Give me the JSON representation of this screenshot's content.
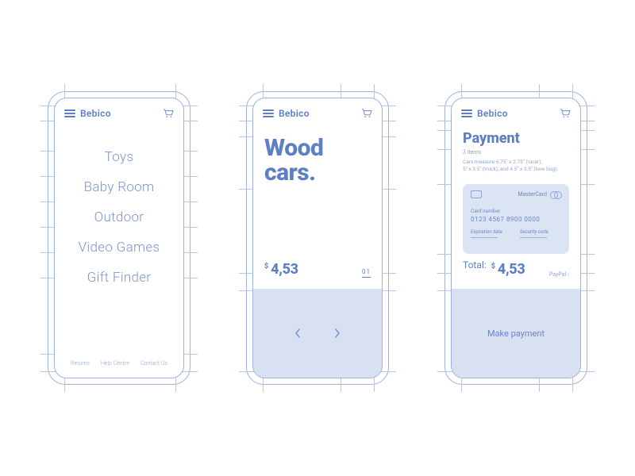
{
  "brand": "Bebico",
  "screen1": {
    "categories": [
      "Toys",
      "Baby Room",
      "Outdoor",
      "Video Games",
      "Gift Finder"
    ],
    "footer": [
      "Returns",
      "Help Centre",
      "Contact Us"
    ]
  },
  "screen2": {
    "headline_l1": "Wood",
    "headline_l2": "cars.",
    "currency": "$",
    "price": "4,53",
    "page": "01"
  },
  "screen3": {
    "title": "Payment",
    "sub": "3 items",
    "desc_l1": "Cars measure 6.75\" x 2.75\" (racer),",
    "desc_l2": "5\" x 3.5\" (truck), and 4.5\" x 3.5\" (love bug).",
    "card_brand": "MasterCard",
    "card_label": "Card number",
    "card_num": "0123 4567 8900 0000",
    "exp_label": "Expiration date",
    "cvv_label": "Security code",
    "total_label": "Total:",
    "currency": "$",
    "total": "4,53",
    "alt_pay": "PayPal ›",
    "cta": "Make payment"
  }
}
